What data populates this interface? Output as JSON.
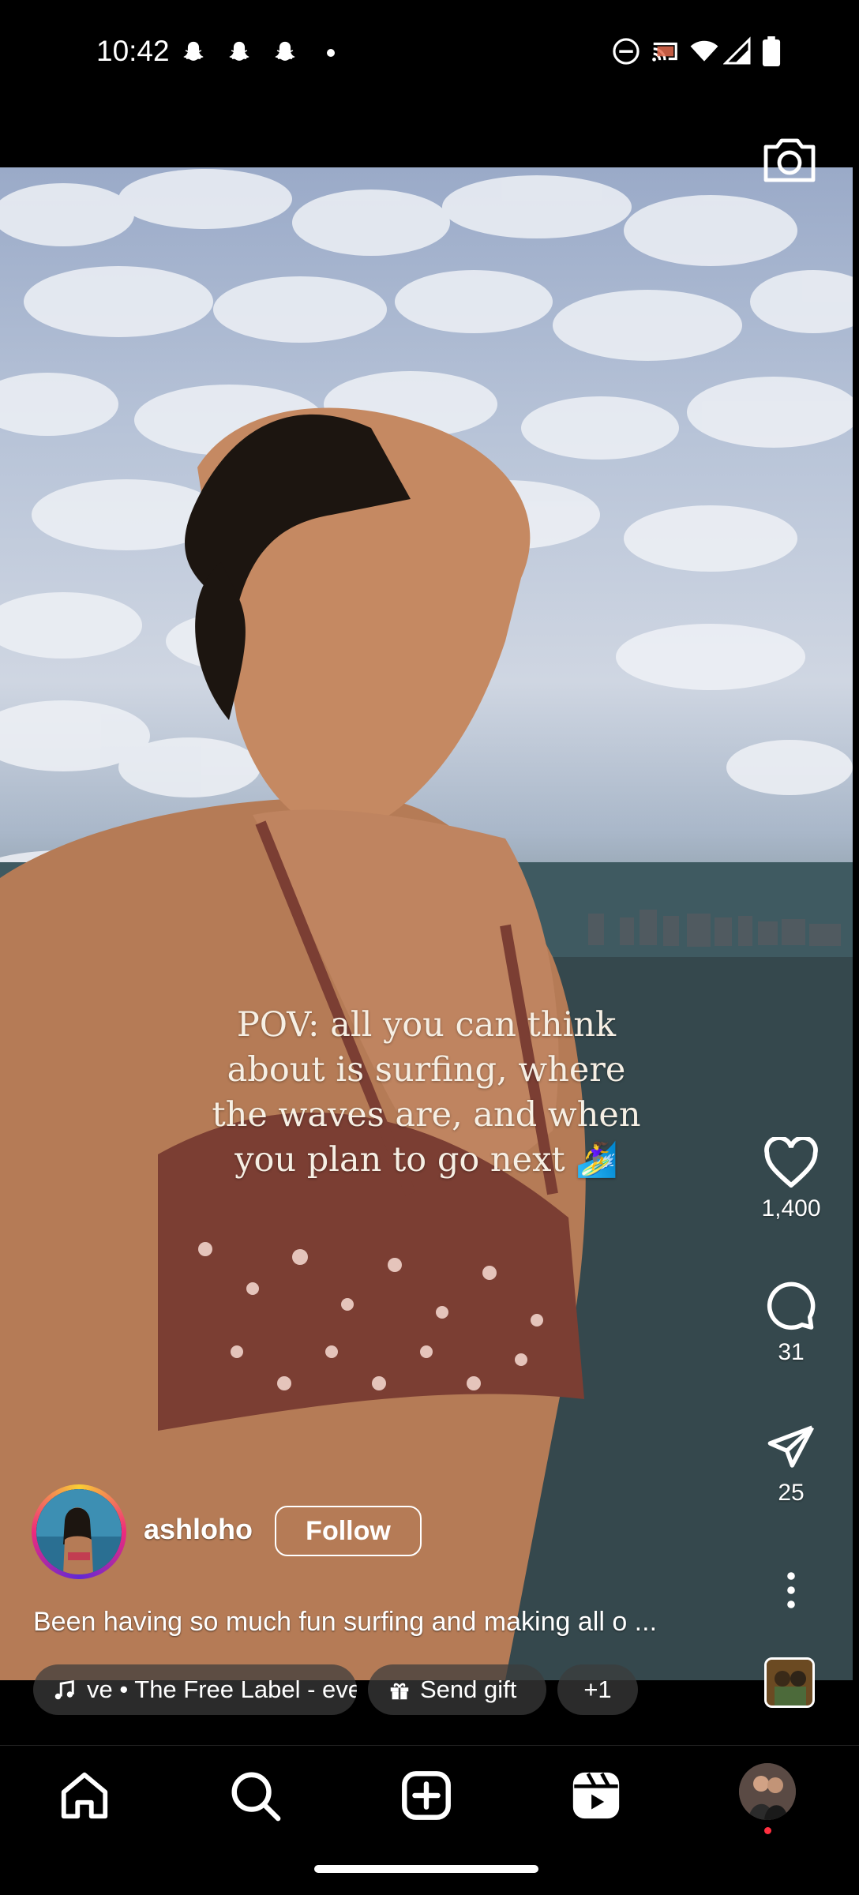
{
  "status_bar": {
    "time": "10:42",
    "notification_icons": [
      "snapchat-icon",
      "snapchat-icon",
      "snapchat-icon",
      "dot-icon"
    ],
    "system_icons": [
      "do-not-disturb-icon",
      "cast-icon",
      "wifi-icon",
      "signal-icon",
      "battery-icon"
    ]
  },
  "reel": {
    "overlay_text": "POV: all you can think about is surfing, where the waves are, and when you plan to go next 🏄‍♀️",
    "actions": {
      "likes": "1,400",
      "comments": "31",
      "shares": "25"
    },
    "author": {
      "username": "ashloho",
      "follow_label": "Follow"
    },
    "caption": "Been having so much fun surfing and making all o ...",
    "chips": {
      "music": "ve • The Free Label - eve",
      "gift": "Send gift",
      "more": "+1"
    }
  },
  "bottom_nav": {
    "items": [
      "home-icon",
      "search-icon",
      "create-icon",
      "reels-icon",
      "profile-avatar"
    ]
  },
  "colors": {
    "background": "#000000",
    "text": "#ffffff",
    "notification_dot": "#ff3040"
  }
}
